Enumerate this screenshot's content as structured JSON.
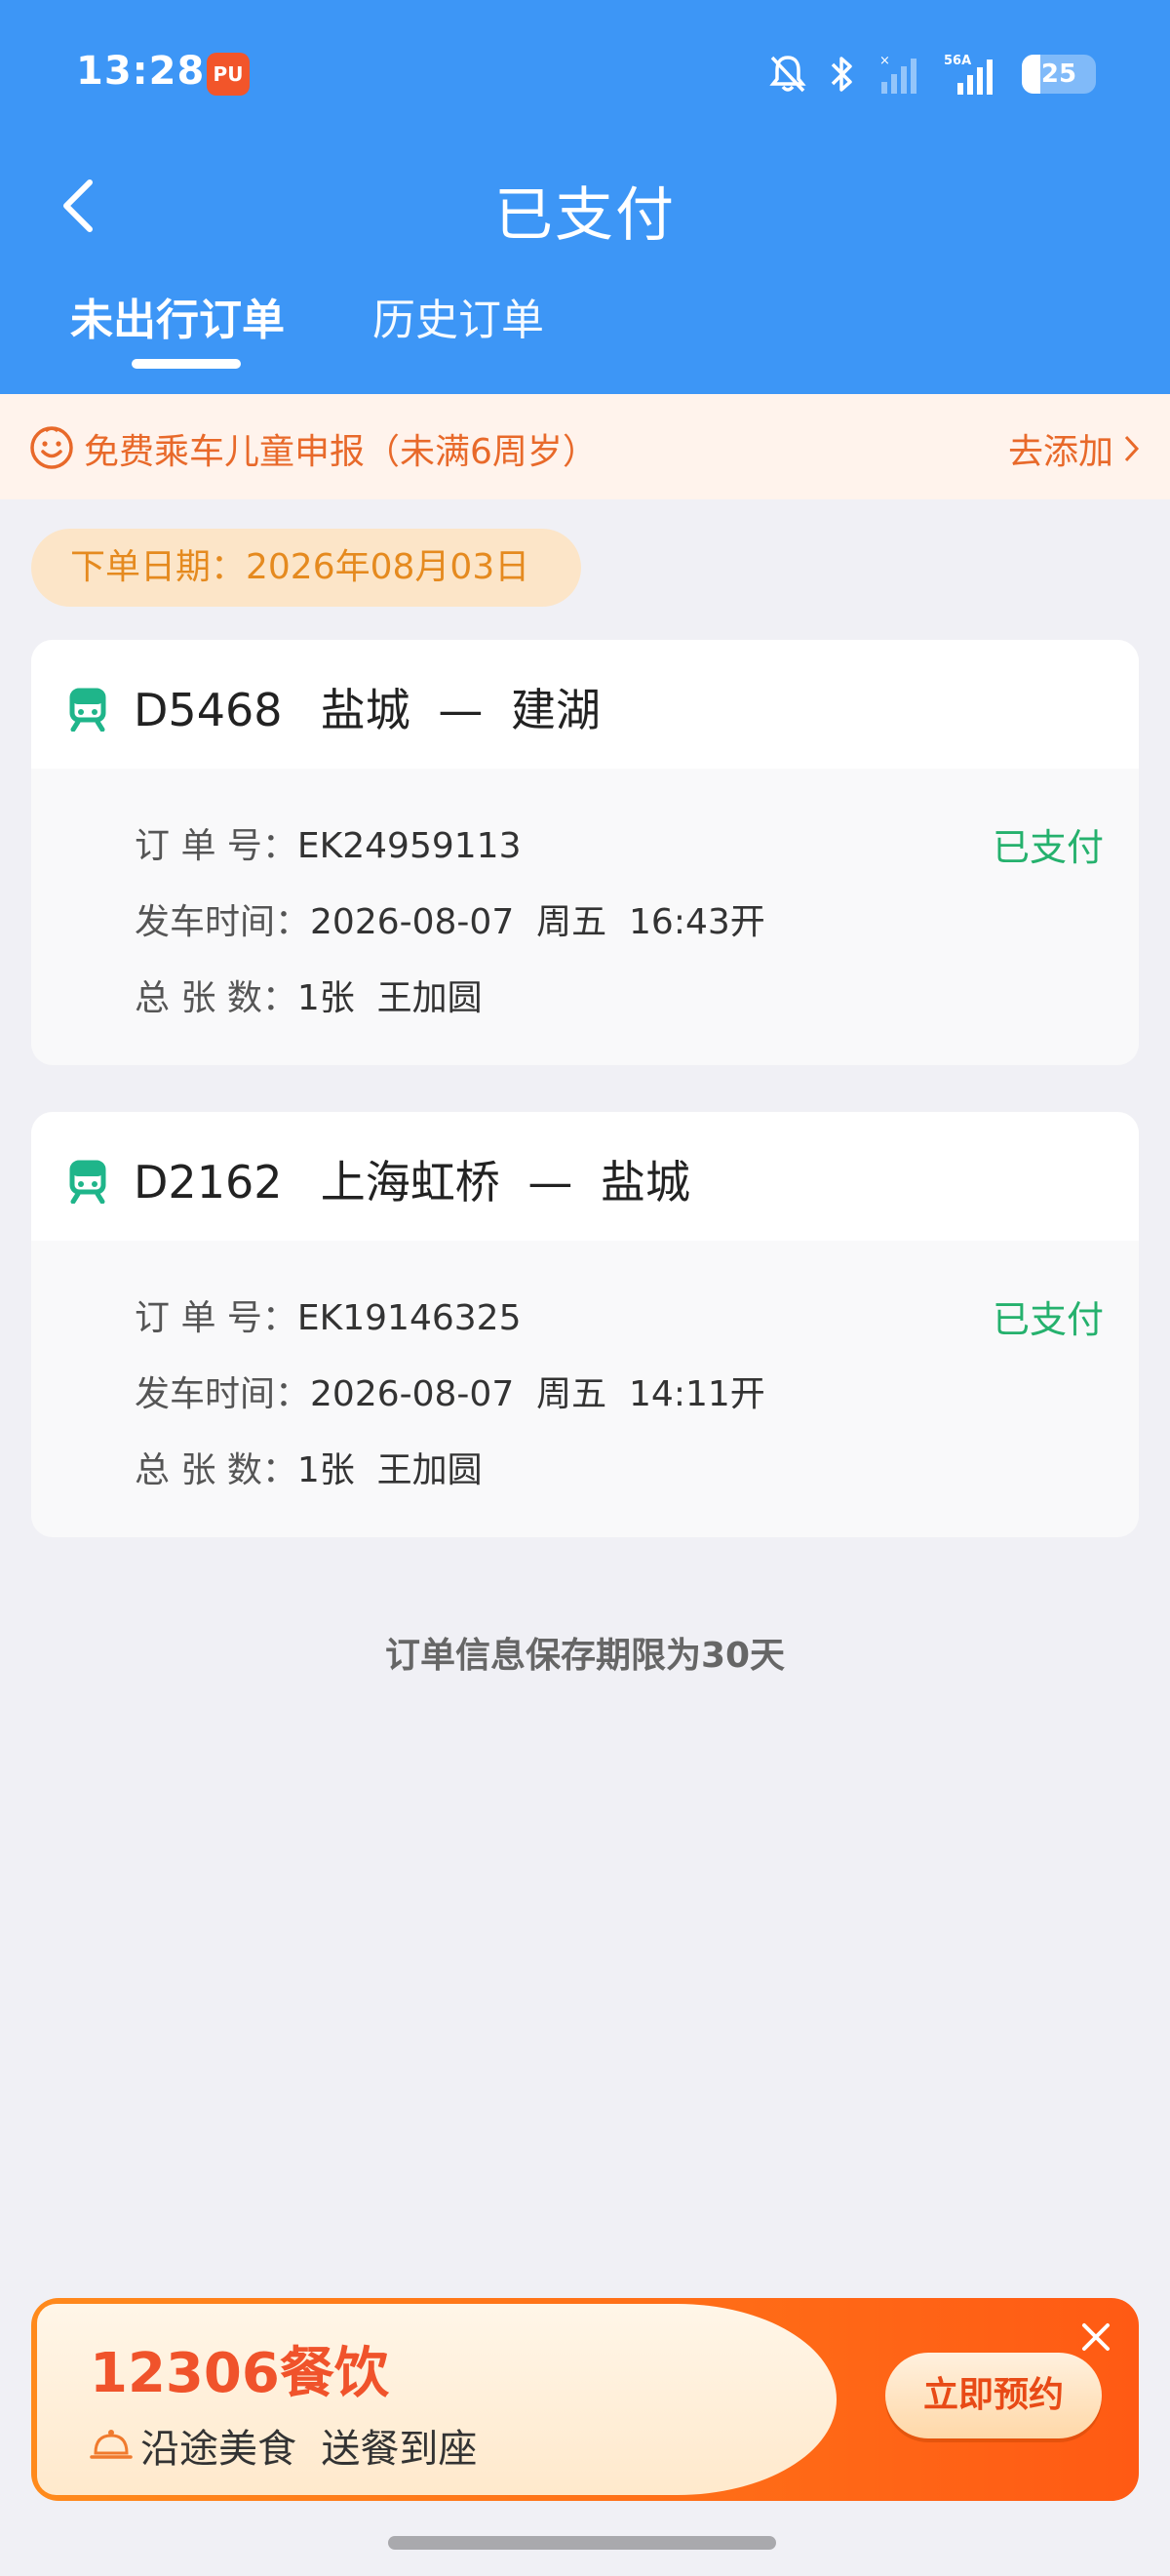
{
  "status_bar": {
    "time": "13:28",
    "app_badge": "PU",
    "battery_level": "25",
    "network_label": "5G"
  },
  "header": {
    "title": "已支付",
    "tabs": [
      {
        "label": "未出行订单",
        "active": true
      },
      {
        "label": "历史订单",
        "active": false
      }
    ]
  },
  "notice": {
    "text": "免费乘车儿童申报（未满6周岁）",
    "action": "去添加"
  },
  "order_date": "下单日期：2026年08月03日",
  "orders": [
    {
      "train": "D5468",
      "from": "盐城",
      "to": "建湖",
      "sep": "—",
      "order_no_label": "订 单 号：",
      "order_no": "EK24959113",
      "departure_label": "发车时间：",
      "departure": "2026-08-07  周五  16:43开",
      "count_label": "总 张 数：",
      "count": "1张  王加圆",
      "status": "已支付"
    },
    {
      "train": "D2162",
      "from": "上海虹桥",
      "to": "盐城",
      "sep": "—",
      "order_no_label": "订 单 号：",
      "order_no": "EK19146325",
      "departure_label": "发车时间：",
      "departure": "2026-08-07  周五  14:11开",
      "count_label": "总 张 数：",
      "count": "1张  王加圆",
      "status": "已支付"
    }
  ],
  "footer_note": "订单信息保存期限为30天",
  "promo": {
    "title": "12306餐饮",
    "subtitle": "沿途美食  送餐到座",
    "button": "立即预约"
  },
  "colors": {
    "header_blue": "#3D96F6",
    "accent_orange": "#E8692A",
    "paid_green": "#25B16D",
    "train_icon_green": "#1FB58A"
  }
}
